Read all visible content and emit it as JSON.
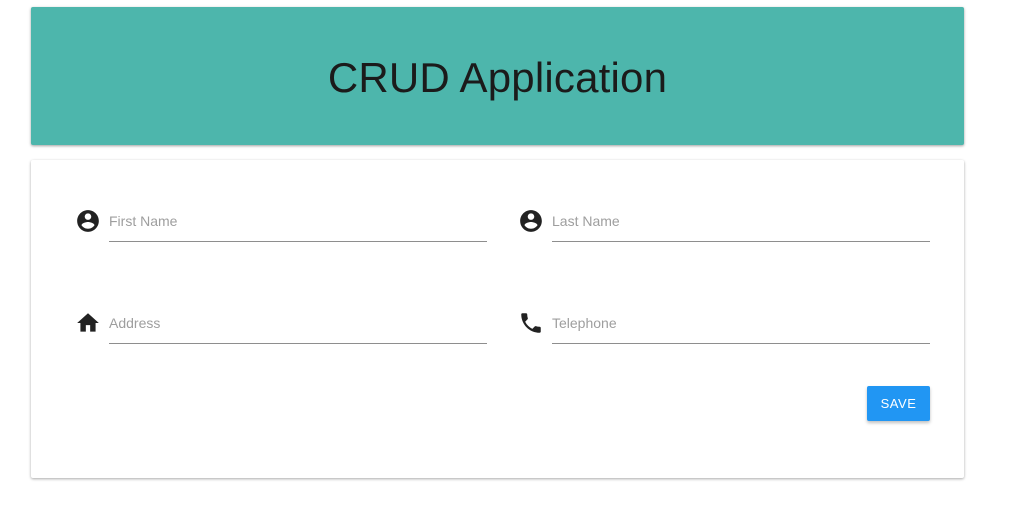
{
  "header": {
    "title": "CRUD Application",
    "background_color": "#4db6ac"
  },
  "form": {
    "fields": [
      {
        "placeholder": "First Name",
        "value": "",
        "icon": "account-circle-icon"
      },
      {
        "placeholder": "Last Name",
        "value": "",
        "icon": "account-circle-icon"
      },
      {
        "placeholder": "Address",
        "value": "",
        "icon": "home-icon"
      },
      {
        "placeholder": "Telephone",
        "value": "",
        "icon": "phone-icon"
      }
    ],
    "save_label": "SAVE",
    "save_color": "#2196f3"
  }
}
